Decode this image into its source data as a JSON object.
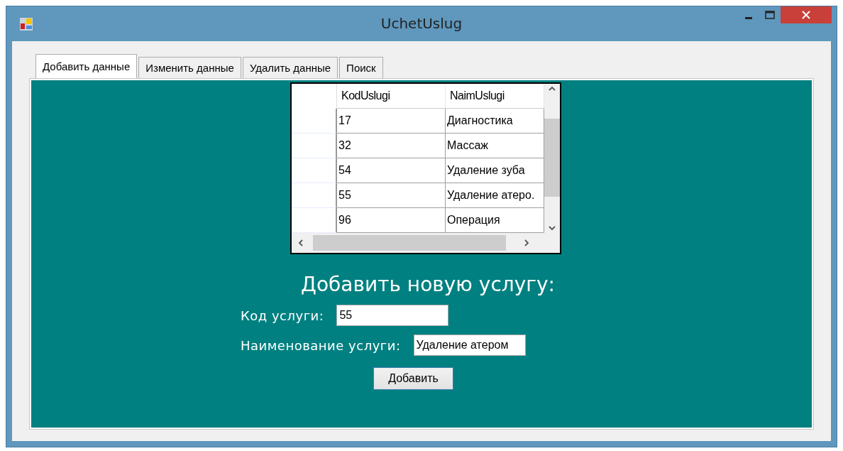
{
  "window": {
    "title": "UchetUslug"
  },
  "tabs": [
    {
      "label": "Добавить данные",
      "selected": true
    },
    {
      "label": "Изменить данные",
      "selected": false
    },
    {
      "label": "Удалить данные",
      "selected": false
    },
    {
      "label": "Поиск",
      "selected": false
    }
  ],
  "table": {
    "columns": [
      "KodUslugi",
      "NaimUslugi"
    ],
    "rows": [
      [
        "17",
        "Диагностика"
      ],
      [
        "32",
        "Массаж"
      ],
      [
        "54",
        "Удаление зуба"
      ],
      [
        "55",
        "Удаление атеро."
      ],
      [
        "96",
        "Операция"
      ]
    ]
  },
  "form": {
    "heading": "Добавить новую услугу:",
    "fields": [
      {
        "label": "Код услуги:",
        "value": "55"
      },
      {
        "label": "Наименование услуги:",
        "value": "Удаление атером"
      }
    ],
    "button": "Добавить"
  }
}
